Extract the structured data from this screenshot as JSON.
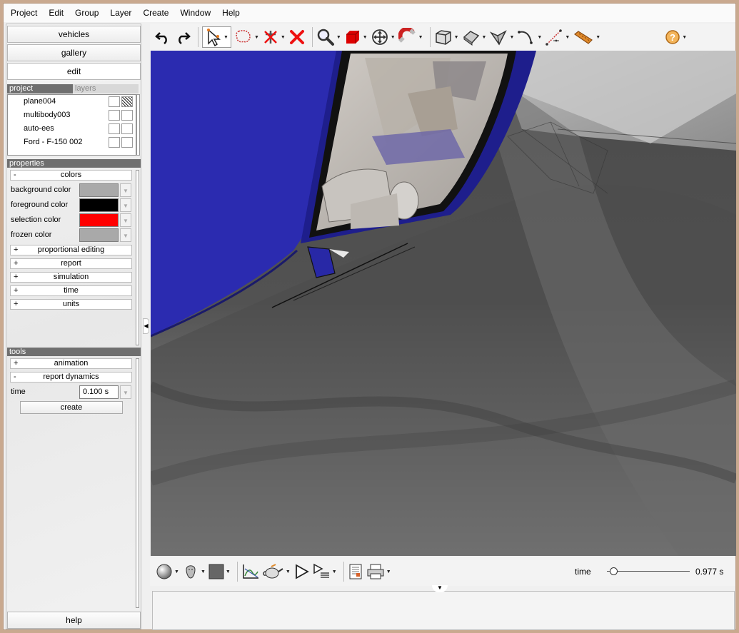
{
  "menu": [
    "Project",
    "Edit",
    "Group",
    "Layer",
    "Create",
    "Window",
    "Help"
  ],
  "nav": {
    "vehicles": "vehicles",
    "gallery": "gallery",
    "edit": "edit",
    "help": "help"
  },
  "tabs": {
    "project": "project",
    "layers": "layers"
  },
  "layers": [
    {
      "name": "plane004",
      "checked": true
    },
    {
      "name": "multibody003",
      "checked": false
    },
    {
      "name": "auto-ees",
      "checked": false
    },
    {
      "name": "Ford - F-150 002",
      "checked": false
    }
  ],
  "properties": {
    "header": "properties",
    "colors_group": "colors",
    "colors": [
      {
        "label": "background color",
        "color": "#a9a9a9"
      },
      {
        "label": "foreground color",
        "color": "#000000"
      },
      {
        "label": "selection color",
        "color": "#ff0000"
      },
      {
        "label": "frozen color",
        "color": "#a9a9a9"
      }
    ],
    "collapsed": [
      "proportional editing",
      "report",
      "simulation",
      "time",
      "units"
    ]
  },
  "tools": {
    "header": "tools",
    "animation": "animation",
    "report_dynamics": "report dynamics",
    "time_label": "time",
    "time_value": "0.100 s",
    "create": "create"
  },
  "signs": {
    "plus": "+",
    "minus": "-"
  },
  "bottom": {
    "time_label": "time",
    "time_value": "0.977 s",
    "time_fraction": 0.05
  },
  "toolbar_icons": [
    "undo-icon",
    "redo-icon",
    "select-arrow-icon",
    "lasso-icon",
    "no-constraint-icon",
    "delete-x-icon",
    "zoom-icon",
    "red-cube-icon",
    "move-icon",
    "magnet-icon",
    "box-view-icon",
    "plane-view-icon",
    "cone-view-icon",
    "curve-icon",
    "measure-icon",
    "ruler-tool-icon",
    "help-icon"
  ]
}
